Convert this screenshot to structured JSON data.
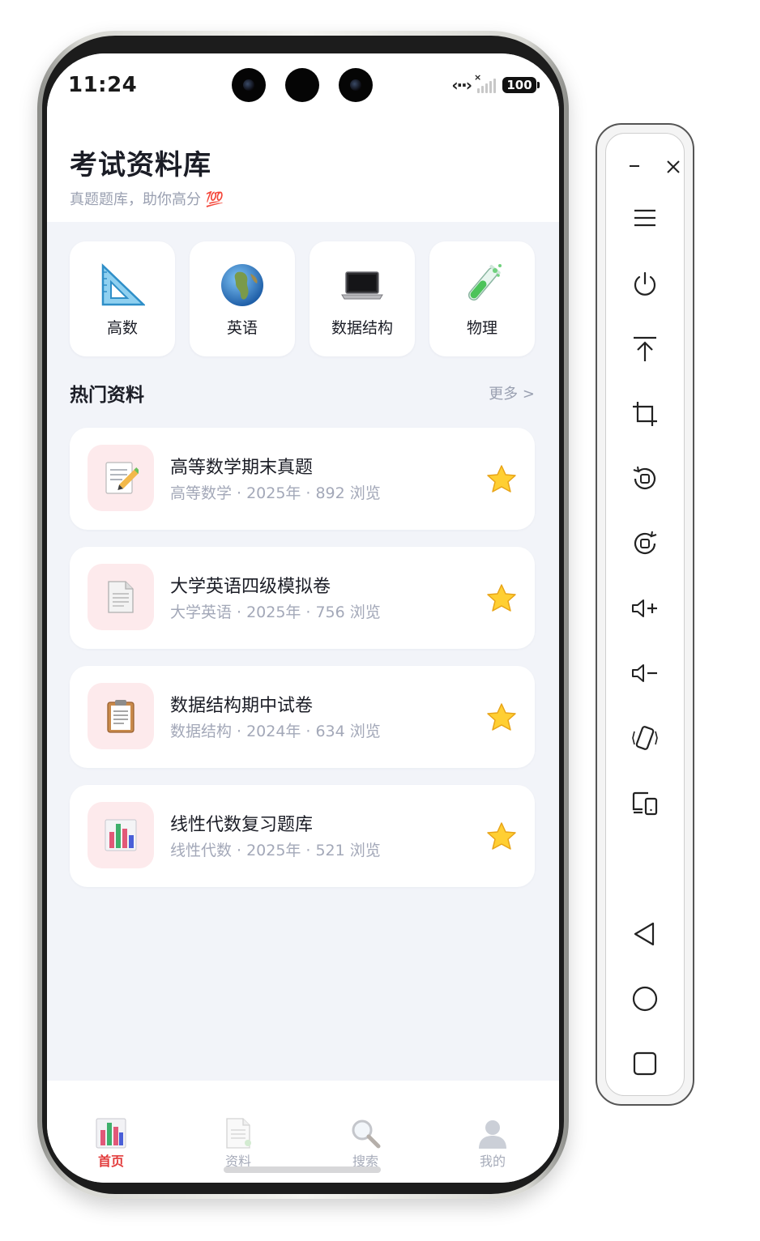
{
  "status_bar": {
    "time": "11:24",
    "battery": "100"
  },
  "header": {
    "title": "考试资料库",
    "subtitle": "真题题库，助你高分 💯"
  },
  "categories": [
    {
      "label": "高数",
      "icon": "triangle-ruler-icon"
    },
    {
      "label": "英语",
      "icon": "globe-icon"
    },
    {
      "label": "数据结构",
      "icon": "laptop-icon"
    },
    {
      "label": "物理",
      "icon": "test-tube-icon"
    }
  ],
  "section": {
    "title": "热门资料",
    "more": "更多 >"
  },
  "materials": [
    {
      "title": "高等数学期末真题",
      "subject": "高等数学",
      "year": "2025年",
      "views": "892 浏览",
      "icon": "memo-icon"
    },
    {
      "title": "大学英语四级模拟卷",
      "subject": "大学英语",
      "year": "2025年",
      "views": "756 浏览",
      "icon": "document-icon"
    },
    {
      "title": "数据结构期中试卷",
      "subject": "数据结构",
      "year": "2024年",
      "views": "634 浏览",
      "icon": "clipboard-icon"
    },
    {
      "title": "线性代数复习题库",
      "subject": "线性代数",
      "year": "2025年",
      "views": "521 浏览",
      "icon": "bar-chart-icon"
    }
  ],
  "meta_separator": "·",
  "tabs": [
    {
      "label": "首页",
      "icon": "bar-chart-icon",
      "active": true
    },
    {
      "label": "资料",
      "icon": "document-icon",
      "active": false
    },
    {
      "label": "搜索",
      "icon": "magnifier-icon",
      "active": false
    },
    {
      "label": "我的",
      "icon": "user-icon",
      "active": false
    }
  ],
  "colors": {
    "accent": "#e23b3b",
    "background": "#f2f4f9",
    "thumb_bg": "#fdeaec",
    "muted_text": "#a3a8b8"
  }
}
